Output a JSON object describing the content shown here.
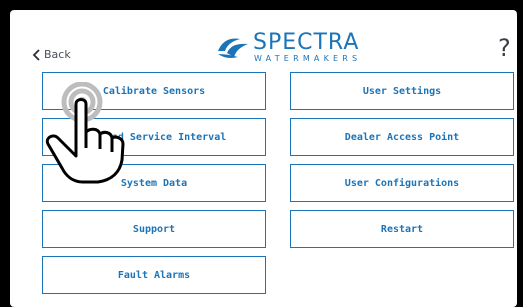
{
  "header": {
    "back_label": "Back",
    "brand": "SPECTRA",
    "brand_sub": "WATERMAKERS",
    "help_label": "?"
  },
  "colors": {
    "accent": "#1c74b8",
    "text_dark": "#3b3f45"
  },
  "menu": {
    "calibrate_sensors": "Calibrate Sensors",
    "service_interval": "Updated Service Interval",
    "system_data": "System Data",
    "support": "Support",
    "fault_alarms": "Fault Alarms",
    "user_settings": "User Settings",
    "dealer_access_point": "Dealer Access Point",
    "user_configurations": "User Configurations",
    "restart": "Restart"
  },
  "overlay": {
    "icon": "tap-hand-icon"
  }
}
